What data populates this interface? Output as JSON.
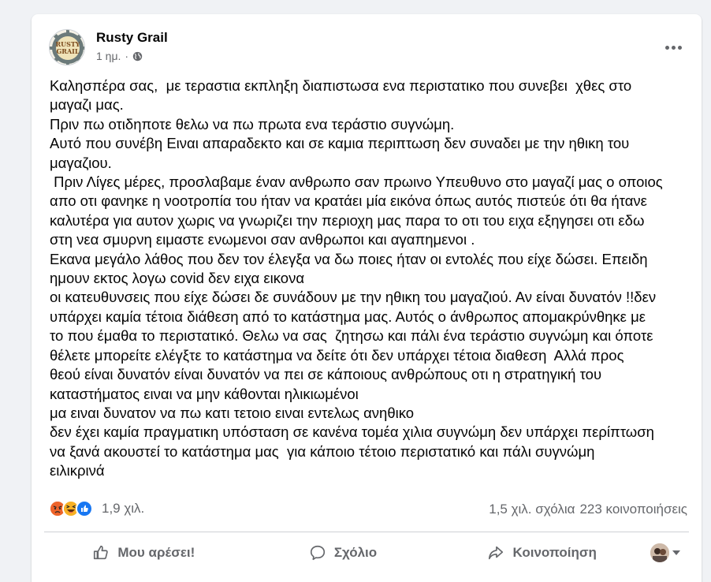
{
  "post": {
    "author": "Rusty Grail",
    "logo_text_top": "RUSTY",
    "logo_text_bottom": "GRAIL",
    "time": "1 ημ.",
    "separator": "·",
    "lines": [
      "Καλησπέρα σας,  με τεραστια εκπληξη διαπιστωσα ενα περιστατικο που συνεβει  χθες στο",
      "μαγαζι μας.",
      "Πριν πω οτιδηποτε θελω να πω πρωτα ενα τεράστιο συγνώμη.",
      "Αυτό που συνέβη Ειναι απαραδεκτο και σε καμια περιπτωση δεν συναδει με την ηθικη του",
      "μαγαζιου.",
      " Πριν Λίγες μέρες, προσλαβαμε έναν ανθρωπο σαν πρωινο Υπευθυνο στο μαγαζί μας ο οποιος",
      "απο οτι φανηκε η νοοτροπία του ήταν να κρατάει μία εικόνα όπως αυτός πιστεύε ότι θα ήτανε",
      "καλυτέρα για αυτον χωρις να γνωριζει την περιοχη μας παρα το οτι του ειχα εξηγησει οτι εδω",
      "στη νεα σμυρνη ειμαστε ενωμενοι σαν ανθρωποι και αγαπημενοι .",
      "Εκανα μεγάλο λάθος που δεν τον έλεγξα να δω ποιες ήταν οι εντολές που είχε δώσει. Επειδη",
      "ημουν εκτος λογω covid δεν ειχα εικονα",
      "οι κατευθυνσεις που είχε δώσει δε συνάδουν με την ηθικη του μαγαζιού. Αν είναι δυνατόν !!δεν",
      "υπάρχει καμία τέτοια διάθεση από το κατάστημα μας. Αυτός ο άνθρωπος απομακρύνθηκε με",
      "το που έμαθα το περιστατικό. Θελω να σας  ζητησω και πάλι ένα τεράστιο συγνώμη και όποτε",
      "θέλετε μπορείτε ελέγξτε το κατάστημα να δείτε ότι δεν υπάρχει τέτοια διαθεση  Αλλά προς",
      "θεού είναι δυνατόν είναι δυνατόν να πει σε κάποιους ανθρώπους οτι η στρατηγική του",
      "καταστήματος ειναι να μην κάθονται ηλικιωμένοι",
      "μα ειναι δυνατον να πω κατι τετοιο ειναι εντελως ανηθικο",
      "δεν έχει καμία πραγματικη υπόσταση σε κανένα τομέα χιλια συγνώμη δεν υπάρχει περίπτωση",
      "να ξανά ακουστεί το κατάστημα μας  για κάποιο τέτοιο περιστατικό και πάλι συγνώμη",
      "ειλικρινά"
    ]
  },
  "stats": {
    "reactions": [
      "angry-icon",
      "haha-icon",
      "like-icon"
    ],
    "reaction_count": "1,9 χιλ.",
    "comments": "1,5 χιλ. σχόλια",
    "shares": "223 κοινοποιήσεις"
  },
  "actions": {
    "like": "Μου αρέσει!",
    "comment": "Σχόλιο",
    "share": "Κοινοποίηση"
  },
  "colors": {
    "background": "#f0f2f5",
    "card": "#ffffff",
    "muted_text": "#65676b",
    "like_blue": "#1877f2",
    "angry_red": "#e9710f",
    "haha_yellow": "#f7b125"
  }
}
